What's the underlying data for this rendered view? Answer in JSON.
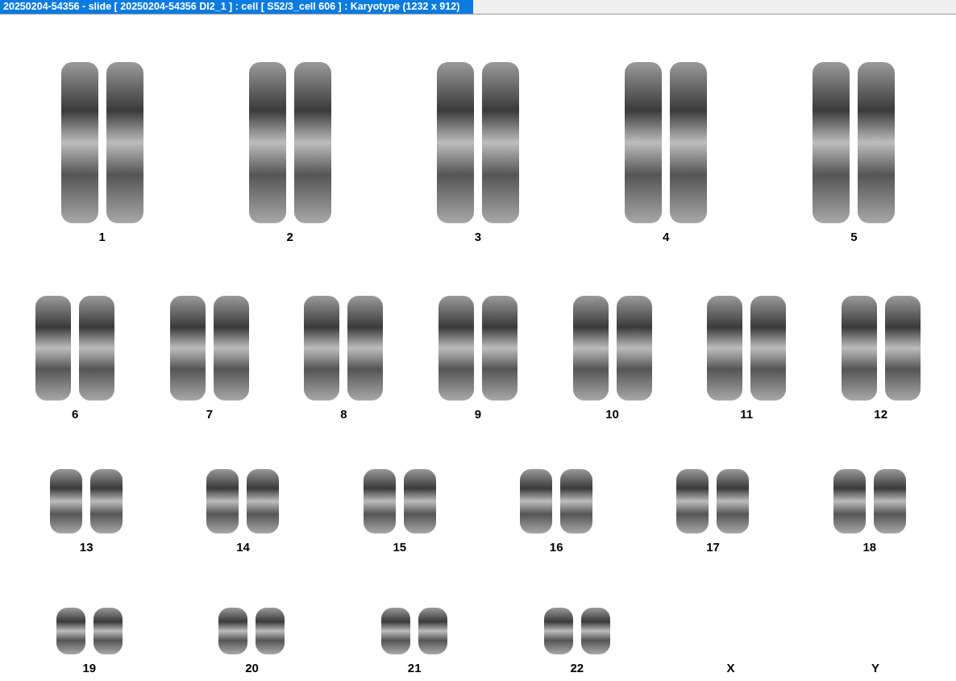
{
  "window": {
    "title": "20250204-54356 - slide [ 20250204-54356 DI2_1 ] : cell [ S52/3_cell 606 ] : Karyotype  (1232 x 912)"
  },
  "karyotype": {
    "rows": [
      {
        "items": [
          {
            "label": "1",
            "kind": "pair"
          },
          {
            "label": "2",
            "kind": "pair"
          },
          {
            "label": "3",
            "kind": "pair"
          },
          {
            "label": "4",
            "kind": "pair"
          },
          {
            "label": "5",
            "kind": "pair"
          }
        ]
      },
      {
        "items": [
          {
            "label": "6",
            "kind": "pair"
          },
          {
            "label": "7",
            "kind": "pair"
          },
          {
            "label": "8",
            "kind": "pair"
          },
          {
            "label": "9",
            "kind": "pair"
          },
          {
            "label": "10",
            "kind": "pair"
          },
          {
            "label": "11",
            "kind": "pair"
          },
          {
            "label": "12",
            "kind": "pair"
          }
        ]
      },
      {
        "items": [
          {
            "label": "13",
            "kind": "pair"
          },
          {
            "label": "14",
            "kind": "pair"
          },
          {
            "label": "15",
            "kind": "pair"
          },
          {
            "label": "16",
            "kind": "pair"
          },
          {
            "label": "17",
            "kind": "pair"
          },
          {
            "label": "18",
            "kind": "pair"
          }
        ]
      },
      {
        "items": [
          {
            "label": "19",
            "kind": "pair"
          },
          {
            "label": "20",
            "kind": "pair"
          },
          {
            "label": "21",
            "kind": "pair"
          },
          {
            "label": "22",
            "kind": "pair"
          },
          {
            "label": "X",
            "kind": "empty"
          },
          {
            "label": "Y",
            "kind": "empty"
          }
        ]
      }
    ]
  }
}
